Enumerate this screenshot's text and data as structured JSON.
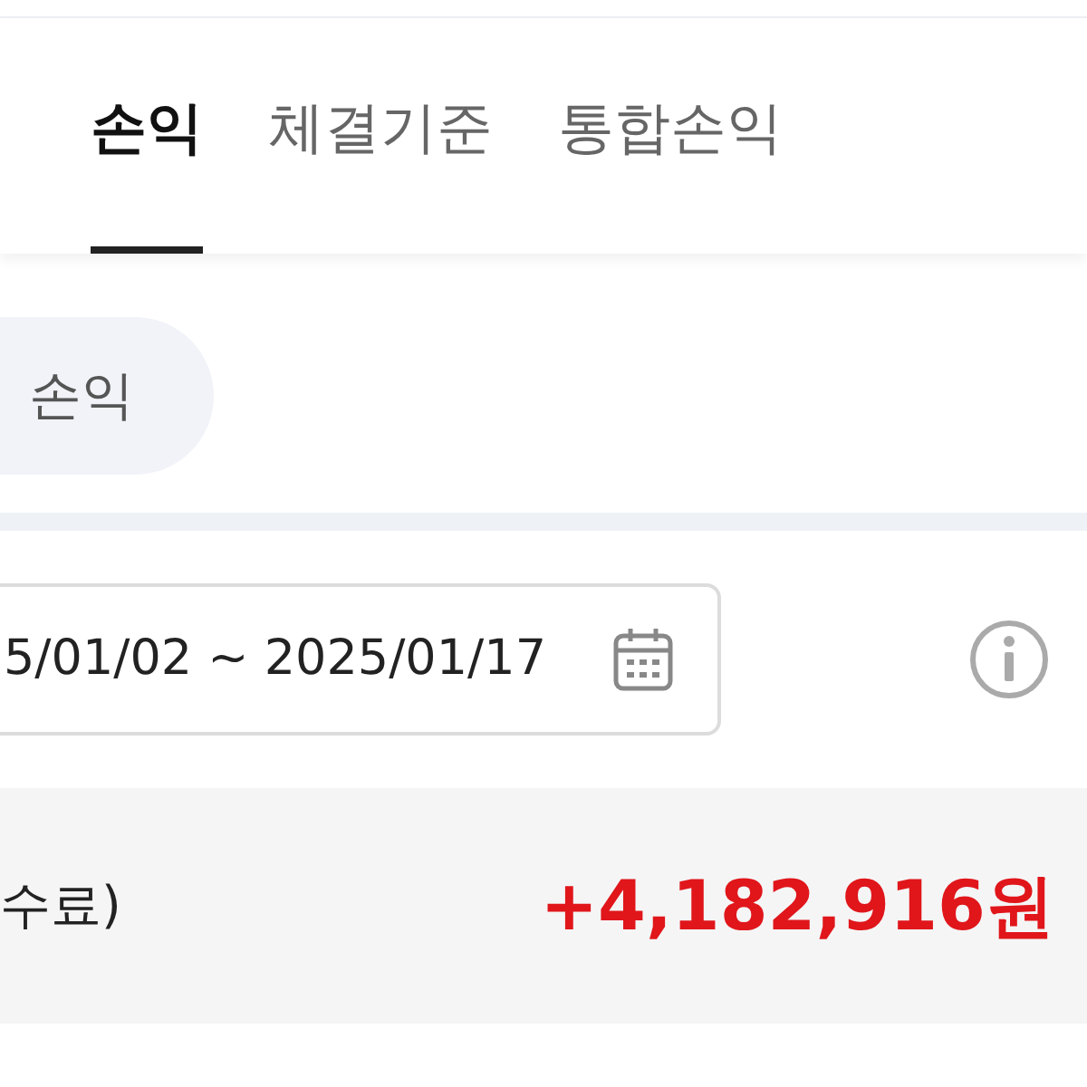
{
  "tabs": [
    {
      "label": "손익",
      "selected": true
    },
    {
      "label": "체결기준",
      "selected": false
    },
    {
      "label": "통합손익",
      "selected": false
    }
  ],
  "filter_chip": {
    "label": "손익"
  },
  "date_range": {
    "value": "5/01/02 ~ 2025/01/17"
  },
  "summary": {
    "label": "수료)",
    "amount": "+4,182,916원"
  }
}
